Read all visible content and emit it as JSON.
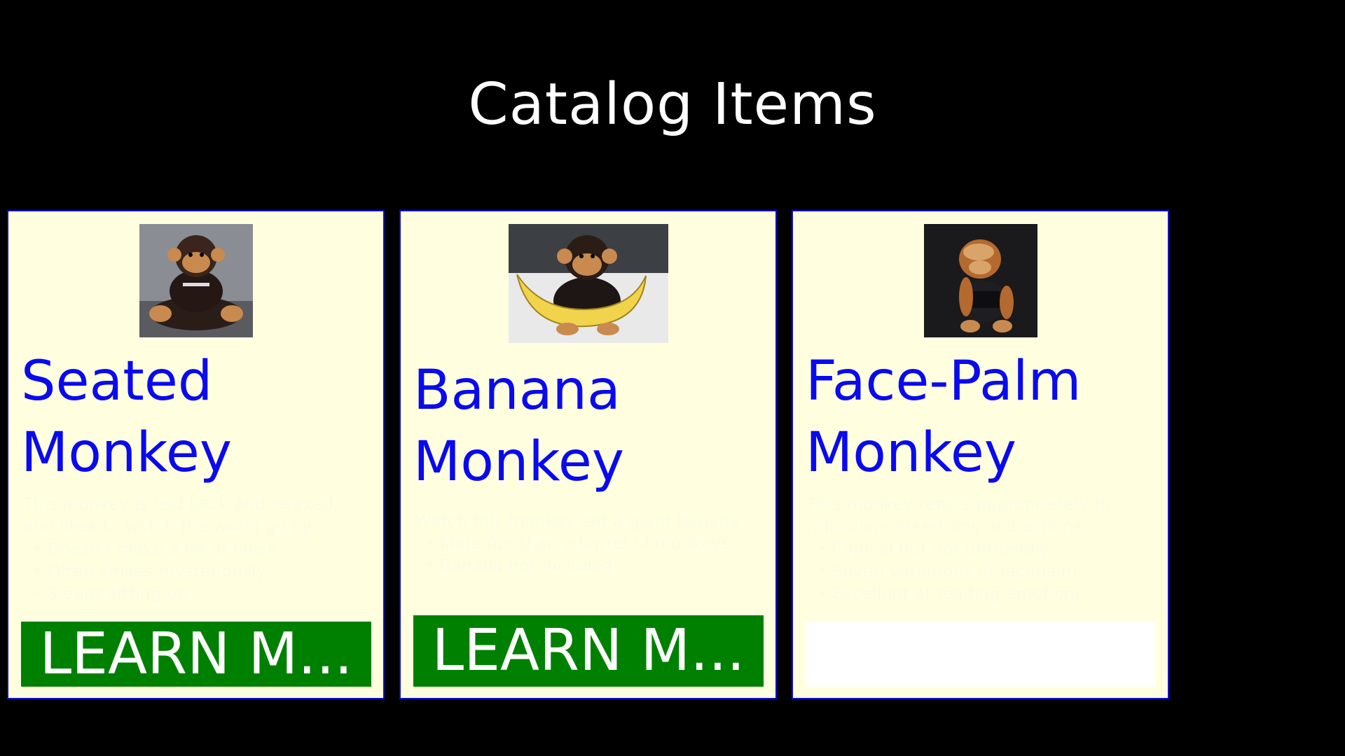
{
  "page": {
    "title": "Catalog Items",
    "background_color": "#000000"
  },
  "cards": [
    {
      "name_line1": "Seated",
      "name_line2": "Monkey",
      "image": "seated-monkey-photo",
      "description_line1": "This monkey is laid back and relaxed,",
      "description_line2": "and likes to watch the world go by.",
      "bullets": [
        "Doesn't make a lot of noise",
        "Often smiles mysteriously",
        "Sleeps sitting up"
      ],
      "button_label": "LEARN M...",
      "button_color": "#008000"
    },
    {
      "name_line1": "Banana",
      "name_line2": "Monkey",
      "image": "banana-monkey-photo",
      "description_line1": "Watch this monkey eat a giant banana.",
      "description_line2": "",
      "bullets": [
        "More fun than a barrel of monkeys",
        "Banana not included"
      ],
      "button_label": "LEARN M...",
      "button_color": "#008000"
    },
    {
      "name_line1": "Face-Palm",
      "name_line2": "Monkey",
      "image": "face-palm-monkey-photo",
      "description_line1": "This monkey reacts appropriately to",
      "description_line2": "ridiculous assertions and actions.",
      "bullets": [
        "Cynical but not unfriendly",
        "Seven variations of facepalm",
        "Excellent at reading emotions"
      ],
      "button_label": "",
      "button_color": "#ffffff"
    }
  ],
  "colors": {
    "card_background": "#ffffe0",
    "card_border": "#1010c8",
    "name_text": "#0a0aee",
    "title_text": "#ffffff"
  }
}
